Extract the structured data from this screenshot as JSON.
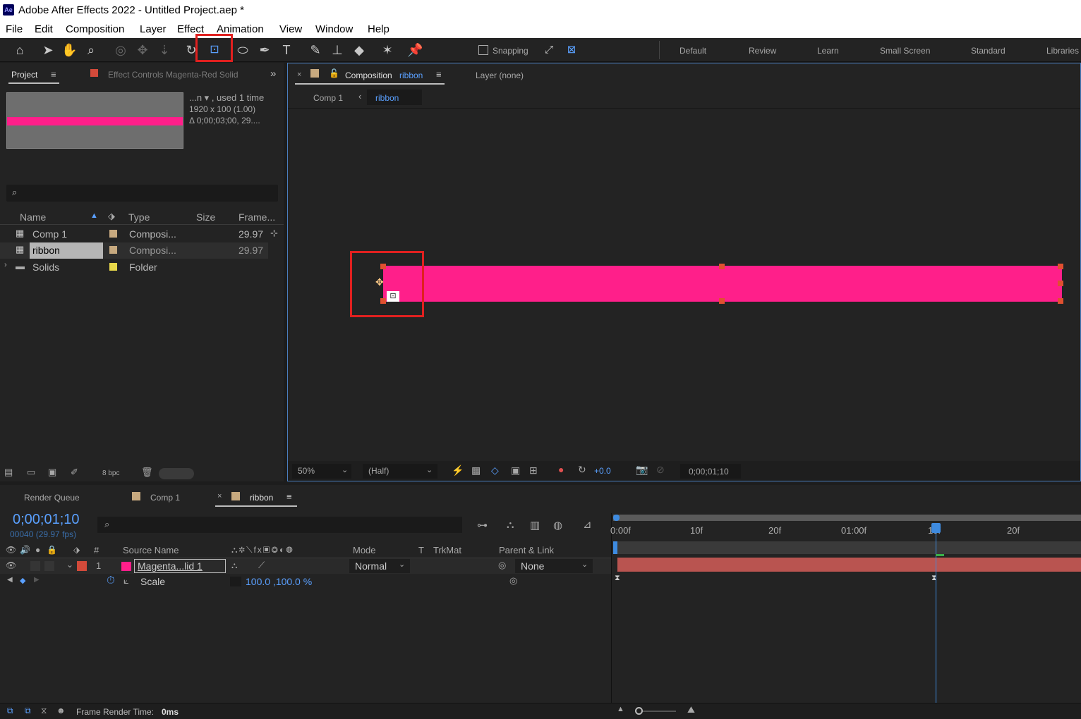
{
  "window": {
    "title": "Adobe After Effects 2022 - Untitled Project.aep *",
    "app_badge": "Ae"
  },
  "menu": [
    "File",
    "Edit",
    "Composition",
    "Layer",
    "Effect",
    "Animation",
    "View",
    "Window",
    "Help"
  ],
  "toolbar": {
    "snapping_label": "Snapping",
    "workspaces": [
      "Default",
      "Review",
      "Learn",
      "Small Screen",
      "Standard",
      "Libraries"
    ]
  },
  "project_panel": {
    "tab_project": "Project",
    "tab_effect_controls": "Effect Controls  Magenta-Red Solid",
    "info_line1": "...n ▾ , used 1 time",
    "info_line2": "1920 x 100 (1.00)",
    "info_line3": "Δ 0;00;03;00, 29....",
    "search_placeholder": "",
    "columns": {
      "name": "Name",
      "type": "Type",
      "size": "Size",
      "frame": "Frame..."
    },
    "items": [
      {
        "name": "Comp 1",
        "type": "Composi...",
        "frame": "29.97",
        "label_color": "#c7a97f"
      },
      {
        "name": "ribbon",
        "type": "Composi...",
        "frame": "29.97",
        "label_color": "#c7a97f"
      },
      {
        "name": "Solids",
        "type": "Folder",
        "frame": "",
        "label_color": "#e8d84a"
      }
    ],
    "bpc": "8 bpc"
  },
  "composition_panel": {
    "tab_label": "Composition",
    "tab_comp_name": "ribbon",
    "layer_tab": "Layer (none)",
    "breadcrumb": [
      "Comp 1",
      "ribbon"
    ],
    "zoom": "50%",
    "resolution": "(Half)",
    "exposure": "+0.0",
    "timecode": "0;00;01;10",
    "solid_color": "#ff1f8a"
  },
  "timeline": {
    "tabs": [
      "Render Queue",
      "Comp 1",
      "ribbon"
    ],
    "current_time": "0;00;01;10",
    "frame_info": "00040 (29.97 fps)",
    "columns": {
      "source_name": "Source Name",
      "mode": "Mode",
      "t": "T",
      "trkmat": "TrkMat",
      "parent": "Parent & Link",
      "hash": "#"
    },
    "layer": {
      "index": "1",
      "name": "Magenta...lid 1",
      "mode": "Normal",
      "parent": "None",
      "color": "#ff1f8a"
    },
    "property": {
      "name": "Scale",
      "value": "100.0 ,100.0 %"
    },
    "ruler_ticks": [
      "0:00f",
      "10f",
      "20f",
      "01:00f",
      "10f",
      "20f"
    ],
    "status": {
      "label": "Frame Render Time:",
      "value": "0ms"
    }
  }
}
